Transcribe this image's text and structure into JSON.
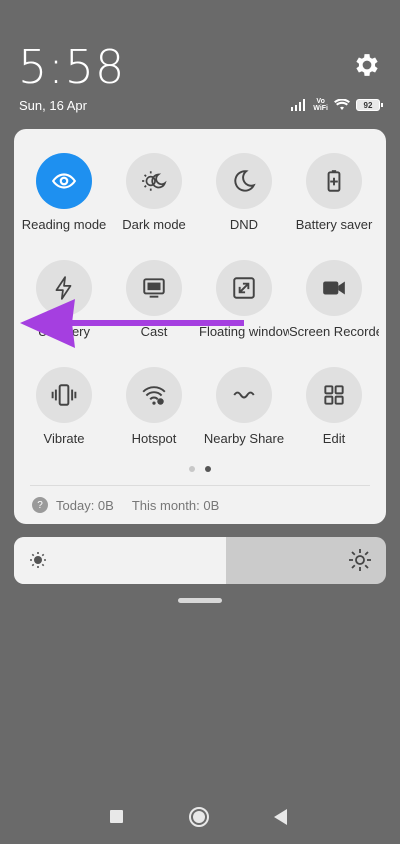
{
  "status": {
    "time": "5:58",
    "date": "Sun, 16 Apr",
    "volte_line1": "Vo",
    "volte_line2": "WiFi",
    "battery_level": "92"
  },
  "tiles": [
    {
      "label": "Reading mode",
      "icon": "eye-icon",
      "active": true
    },
    {
      "label": "Dark mode",
      "icon": "dark-mode-icon",
      "active": false
    },
    {
      "label": "DND",
      "icon": "moon-icon",
      "active": false
    },
    {
      "label": "Battery saver",
      "icon": "battery-plus-icon",
      "active": false
    },
    {
      "label": "Ultra battery",
      "label_visible": "Ult   attery",
      "icon": "lightning-icon",
      "active": false
    },
    {
      "label": "Cast",
      "icon": "cast-icon",
      "active": false
    },
    {
      "label": "Floating window",
      "icon": "floating-window-icon",
      "active": false
    },
    {
      "label": "Screen Recorder",
      "icon": "video-camera-icon",
      "active": false
    },
    {
      "label": "Vibrate",
      "icon": "vibrate-icon",
      "active": false
    },
    {
      "label": "Hotspot",
      "icon": "hotspot-icon",
      "active": false
    },
    {
      "label": "Nearby Share",
      "icon": "nearby-share-icon",
      "active": false
    },
    {
      "label": "Edit",
      "icon": "grid-icon",
      "active": false
    }
  ],
  "data_usage": {
    "today": "Today: 0B",
    "month": "This month: 0B"
  },
  "brightness": {
    "level": 0.57
  },
  "colors": {
    "accent": "#1e90f0",
    "arrow": "#a53fe0"
  }
}
